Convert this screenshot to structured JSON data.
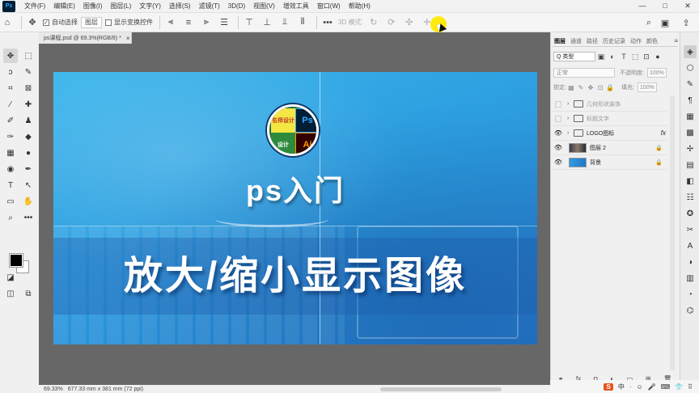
{
  "app": {
    "logo": "Ps",
    "menu": [
      "文件(F)",
      "编辑(E)",
      "图像(I)",
      "图层(L)",
      "文字(Y)",
      "选择(S)",
      "滤镜(T)",
      "3D(D)",
      "视图(V)",
      "增效工具",
      "窗口(W)",
      "帮助(H)"
    ],
    "window_controls": [
      "—",
      "□",
      "✕"
    ]
  },
  "options_bar": {
    "auto_select_label": "自动选择",
    "auto_select_target": "图层",
    "show_transform_label": "显示变换控件",
    "mode_3d_label": "3D 模式:",
    "more": "•••"
  },
  "document": {
    "tab_title": "ps课程.psd @ 69.3%(RGB/8) *",
    "tab_close": "×"
  },
  "canvas": {
    "badge": {
      "q1": "名师设计",
      "q2": "Ps",
      "q3": "设计",
      "q4": "Ai"
    },
    "title_small": "ps入门",
    "title_main": "放大/缩小显示图像"
  },
  "status": {
    "zoom": "69.33%",
    "doc_size": "677.33 mm x 381 mm (72 ppi)"
  },
  "layers_panel": {
    "tabs": [
      "图层",
      "通道",
      "路径",
      "历史记录",
      "动作",
      "颜色"
    ],
    "filter_label": "Q 类型",
    "blend_mode": "正常",
    "opacity_label": "不透明度:",
    "opacity_value": "100%",
    "lock_label": "锁定:",
    "fill_label": "填充:",
    "fill_value": "100%",
    "layers": [
      {
        "name": "几何形状装饰",
        "visible": false,
        "type": "group"
      },
      {
        "name": "标题文字",
        "visible": false,
        "type": "group"
      },
      {
        "name": "LOGO图标",
        "visible": true,
        "type": "group",
        "fx": "fx"
      },
      {
        "name": "图层 2",
        "visible": true,
        "type": "pixel",
        "locked": true
      },
      {
        "name": "背景",
        "visible": true,
        "type": "background",
        "locked": true
      }
    ],
    "footer_icons": [
      "link-icon",
      "fx-icon",
      "mask-icon",
      "adjustment-icon",
      "group-icon",
      "new-layer-icon",
      "delete-icon"
    ]
  },
  "taskbar": {
    "ime": "S",
    "lang": "中",
    "items": [
      "·",
      "☺",
      "🎤",
      "⌨",
      "👕",
      "⠿"
    ]
  }
}
